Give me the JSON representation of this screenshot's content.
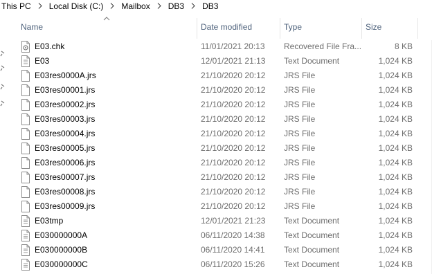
{
  "breadcrumb": {
    "items": [
      "This PC",
      "Local Disk (C:)",
      "Mailbox",
      "DB3",
      "DB3"
    ]
  },
  "columns": {
    "name": "Name",
    "date": "Date modified",
    "type": "Type",
    "size": "Size"
  },
  "files": [
    {
      "name": "E03.chk",
      "date": "11/01/2021 20:13",
      "type": "Recovered File Fra...",
      "size": "8 KB",
      "icon": "recovered-file-icon"
    },
    {
      "name": "E03",
      "date": "12/01/2021 21:13",
      "type": "Text Document",
      "size": "1,024 KB",
      "icon": "text-document-icon"
    },
    {
      "name": "E03res0000A.jrs",
      "date": "21/10/2020 20:12",
      "type": "JRS File",
      "size": "1,024 KB",
      "icon": "file-icon"
    },
    {
      "name": "E03res00001.jrs",
      "date": "21/10/2020 20:12",
      "type": "JRS File",
      "size": "1,024 KB",
      "icon": "file-icon"
    },
    {
      "name": "E03res00002.jrs",
      "date": "21/10/2020 20:12",
      "type": "JRS File",
      "size": "1,024 KB",
      "icon": "file-icon"
    },
    {
      "name": "E03res00003.jrs",
      "date": "21/10/2020 20:12",
      "type": "JRS File",
      "size": "1,024 KB",
      "icon": "file-icon"
    },
    {
      "name": "E03res00004.jrs",
      "date": "21/10/2020 20:12",
      "type": "JRS File",
      "size": "1,024 KB",
      "icon": "file-icon"
    },
    {
      "name": "E03res00005.jrs",
      "date": "21/10/2020 20:12",
      "type": "JRS File",
      "size": "1,024 KB",
      "icon": "file-icon"
    },
    {
      "name": "E03res00006.jrs",
      "date": "21/10/2020 20:12",
      "type": "JRS File",
      "size": "1,024 KB",
      "icon": "file-icon"
    },
    {
      "name": "E03res00007.jrs",
      "date": "21/10/2020 20:12",
      "type": "JRS File",
      "size": "1,024 KB",
      "icon": "file-icon"
    },
    {
      "name": "E03res00008.jrs",
      "date": "21/10/2020 20:12",
      "type": "JRS File",
      "size": "1,024 KB",
      "icon": "file-icon"
    },
    {
      "name": "E03res00009.jrs",
      "date": "21/10/2020 20:12",
      "type": "JRS File",
      "size": "1,024 KB",
      "icon": "file-icon"
    },
    {
      "name": "E03tmp",
      "date": "12/01/2021 21:23",
      "type": "Text Document",
      "size": "1,024 KB",
      "icon": "text-document-icon"
    },
    {
      "name": "E030000000A",
      "date": "06/11/2020 14:38",
      "type": "Text Document",
      "size": "1,024 KB",
      "icon": "text-document-icon"
    },
    {
      "name": "E030000000B",
      "date": "06/11/2020 14:41",
      "type": "Text Document",
      "size": "1,024 KB",
      "icon": "text-document-icon"
    },
    {
      "name": "E030000000C",
      "date": "06/11/2020 15:26",
      "type": "Text Document",
      "size": "1,024 KB",
      "icon": "text-document-icon"
    }
  ],
  "colors": {
    "header_text": "#4c607a",
    "detail_text": "#6d6d6d",
    "divider": "#e5e5e5"
  }
}
